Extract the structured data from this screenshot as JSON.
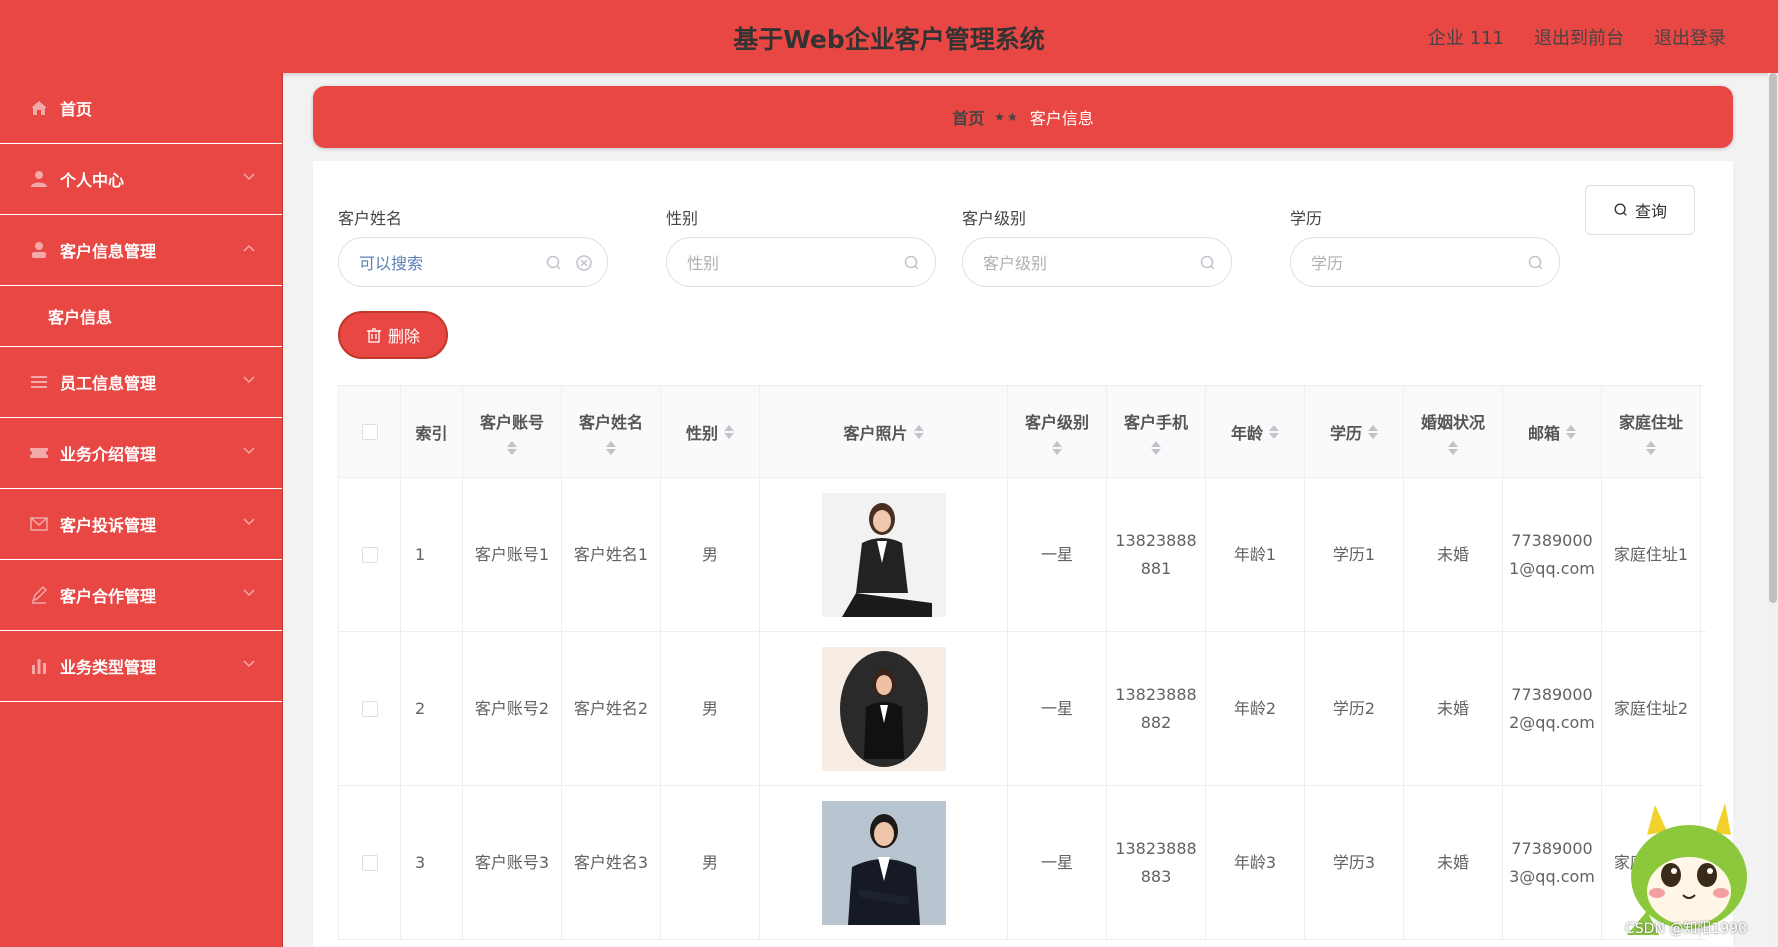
{
  "header": {
    "title": "基于Web企业客户管理系统",
    "user": "企业 111",
    "to_front": "退出到前台",
    "logout": "退出登录"
  },
  "sidebar": {
    "items": [
      {
        "label": "首页",
        "icon": "home-icon"
      },
      {
        "label": "个人中心",
        "icon": "user-icon"
      },
      {
        "label": "客户信息管理",
        "icon": "customer-icon",
        "sub": [
          "客户信息"
        ]
      },
      {
        "label": "员工信息管理",
        "icon": "list-icon"
      },
      {
        "label": "业务介绍管理",
        "icon": "ticket-icon"
      },
      {
        "label": "客户投诉管理",
        "icon": "mail-icon"
      },
      {
        "label": "客户合作管理",
        "icon": "pen-icon"
      },
      {
        "label": "业务类型管理",
        "icon": "bar-chart-icon"
      }
    ]
  },
  "breadcrumb": {
    "home": "首页",
    "sep": "★★",
    "current": "客户信息"
  },
  "filters": {
    "name": {
      "label": "客户姓名",
      "value": "可以搜索"
    },
    "gender": {
      "label": "性别",
      "placeholder": "性别"
    },
    "level": {
      "label": "客户级别",
      "placeholder": "客户级别"
    },
    "edu": {
      "label": "学历",
      "placeholder": "学历"
    },
    "query": "查询"
  },
  "actions": {
    "delete": "删除"
  },
  "table": {
    "headers": [
      "索引",
      "客户账号",
      "客户姓名",
      "性别",
      "客户照片",
      "客户级别",
      "客户手机",
      "年龄",
      "学历",
      "婚姻状况",
      "邮箱",
      "家庭住址"
    ],
    "rows": [
      {
        "index": "1",
        "account": "客户账号1",
        "name": "客户姓名1",
        "gender": "男",
        "level": "一星",
        "phone": "13823888881",
        "age": "年龄1",
        "edu": "学历1",
        "marriage": "未婚",
        "email": "773890001@qq.com",
        "address": "家庭住址1"
      },
      {
        "index": "2",
        "account": "客户账号2",
        "name": "客户姓名2",
        "gender": "男",
        "level": "一星",
        "phone": "13823888882",
        "age": "年龄2",
        "edu": "学历2",
        "marriage": "未婚",
        "email": "773890002@qq.com",
        "address": "家庭住址2"
      },
      {
        "index": "3",
        "account": "客户账号3",
        "name": "客户姓名3",
        "gender": "男",
        "level": "一星",
        "phone": "13823888883",
        "age": "年龄3",
        "edu": "学历3",
        "marriage": "未婚",
        "email": "773890003@qq.com",
        "address": "家庭住址3"
      }
    ]
  },
  "watermark": "CSDN @知阳1990",
  "colors": {
    "primary": "#e84744",
    "text": "#606266"
  }
}
